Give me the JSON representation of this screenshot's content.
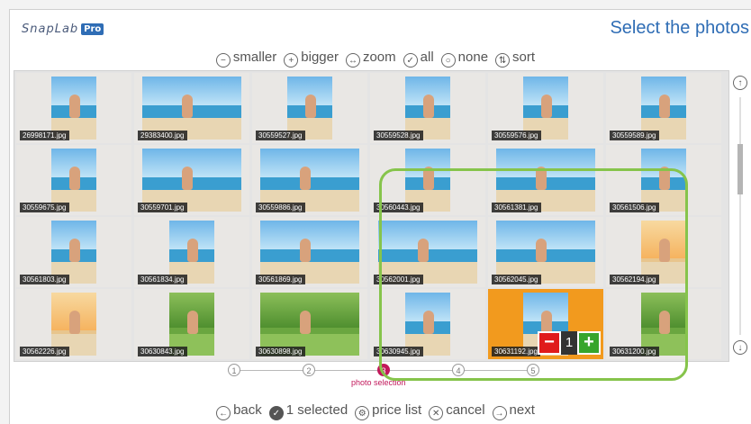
{
  "app": {
    "logo": "SnapLab",
    "logo_badge": "Pro",
    "title": "Select the photos"
  },
  "toolbar": [
    {
      "icon": "zoom-out-icon",
      "glyph": "−",
      "label": "smaller"
    },
    {
      "icon": "zoom-in-icon",
      "glyph": "+",
      "label": "bigger"
    },
    {
      "icon": "zoom-icon",
      "glyph": "↔",
      "label": "zoom"
    },
    {
      "icon": "select-all-icon",
      "glyph": "✓",
      "label": "all"
    },
    {
      "icon": "select-none-icon",
      "glyph": "○",
      "label": "none"
    },
    {
      "icon": "sort-icon",
      "glyph": "⇅",
      "label": "sort"
    }
  ],
  "photos": [
    [
      "26998171.jpg",
      "29383400.jpg",
      "30559527.jpg",
      "30559528.jpg",
      "30559576.jpg",
      "30559589.jpg"
    ],
    [
      "30559675.jpg",
      "30559701.jpg",
      "30559886.jpg",
      "30560443.jpg",
      "30561381.jpg",
      "30561506.jpg"
    ],
    [
      "30561803.jpg",
      "30561834.jpg",
      "30561869.jpg",
      "30562001.jpg",
      "30562045.jpg",
      "30562194.jpg"
    ],
    [
      "30562226.jpg",
      "30630843.jpg",
      "30630898.jpg",
      "30630945.jpg",
      "30631192.jpg",
      "30631200.jpg"
    ]
  ],
  "selected_photo": {
    "filename": "30631192.jpg",
    "quantity": "1",
    "minus": "−",
    "plus": "+"
  },
  "steps": {
    "items": [
      "1",
      "2",
      "3",
      "4",
      "5"
    ],
    "active_index": 2,
    "active_label": "photo selection"
  },
  "bottombar": [
    {
      "icon": "back-arrow-icon",
      "glyph": "←",
      "label": "back"
    },
    {
      "icon": "check-icon",
      "glyph": "✓",
      "label": "1 selected"
    },
    {
      "icon": "price-list-icon",
      "glyph": "⚙",
      "label": "price list"
    },
    {
      "icon": "cancel-icon",
      "glyph": "✕",
      "label": "cancel"
    },
    {
      "icon": "next-arrow-icon",
      "glyph": "→",
      "label": "next"
    }
  ],
  "scroll": {
    "up_glyph": "↑",
    "down_glyph": "↓"
  },
  "colors": {
    "accent": "#2f6db5",
    "selected_cell": "#f29a1e",
    "step_active": "#c2185b",
    "highlight": "#86c44b"
  }
}
